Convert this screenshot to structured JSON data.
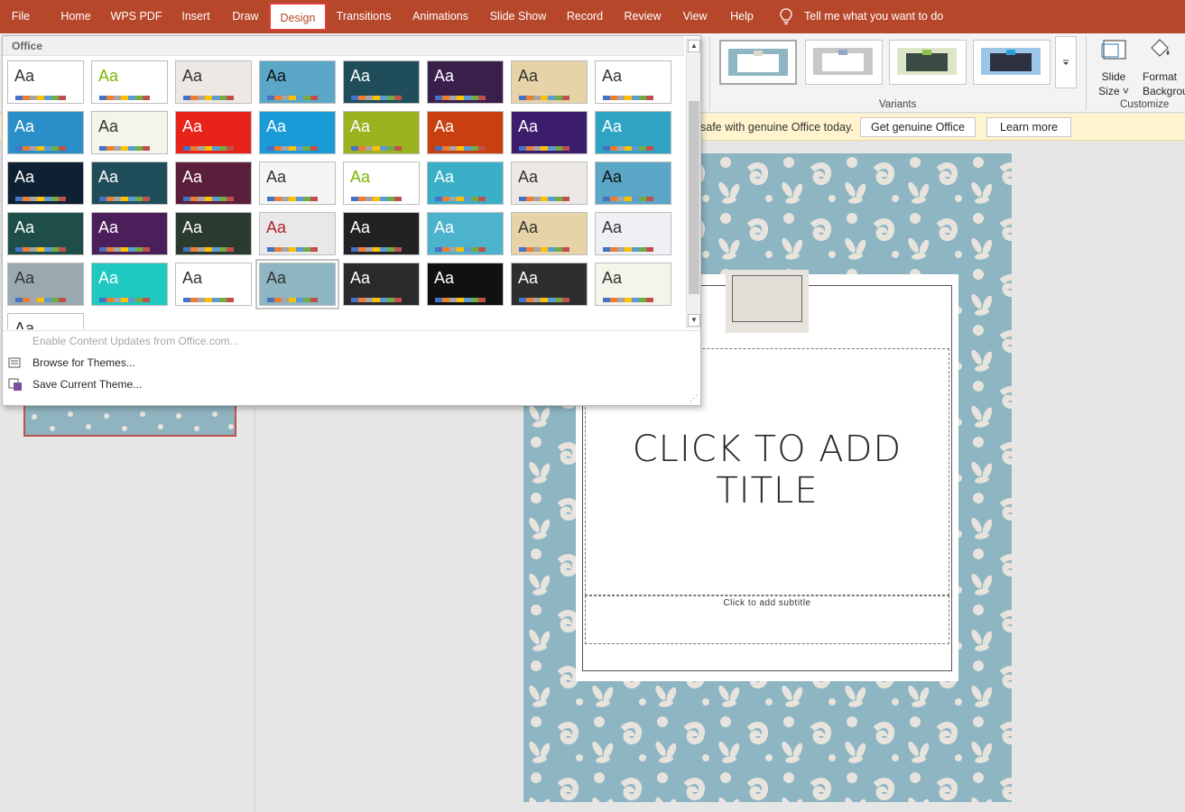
{
  "tabs": [
    {
      "label": "File",
      "active": false
    },
    {
      "label": "Home",
      "active": false
    },
    {
      "label": "WPS PDF",
      "active": false
    },
    {
      "label": "Insert",
      "active": false
    },
    {
      "label": "Draw",
      "active": false
    },
    {
      "label": "Design",
      "active": true
    },
    {
      "label": "Transitions",
      "active": false
    },
    {
      "label": "Animations",
      "active": false
    },
    {
      "label": "Slide Show",
      "active": false
    },
    {
      "label": "Record",
      "active": false
    },
    {
      "label": "Review",
      "active": false
    },
    {
      "label": "View",
      "active": false
    },
    {
      "label": "Help",
      "active": false
    }
  ],
  "tell_me": "Tell me what you want to do",
  "ribbon": {
    "variants_label": "Variants",
    "customize_label": "Customize",
    "slide_size_label": "Slide Size ˅",
    "format_background_label": "Format Background"
  },
  "infobar": {
    "message": "safe with genuine Office today.",
    "get_genuine_button": "Get genuine Office",
    "learn_more_button": "Learn more"
  },
  "themes_dropdown": {
    "section_label": "Office",
    "theme_sample_text": "Aa",
    "menu": {
      "enable_updates": "Enable Content Updates from Office.com...",
      "browse_themes": "Browse for Themes...",
      "save_theme": "Save Current Theme..."
    }
  },
  "slide": {
    "title_placeholder": "CLICK TO ADD TITLE",
    "subtitle_placeholder": "Click to add subtitle"
  },
  "colors": {
    "accent": "#b7472a",
    "slide_pattern_bg": "#8db5c2",
    "slide_pattern_fg": "#e8e3dc",
    "infobar_bg": "#fff4ce"
  }
}
